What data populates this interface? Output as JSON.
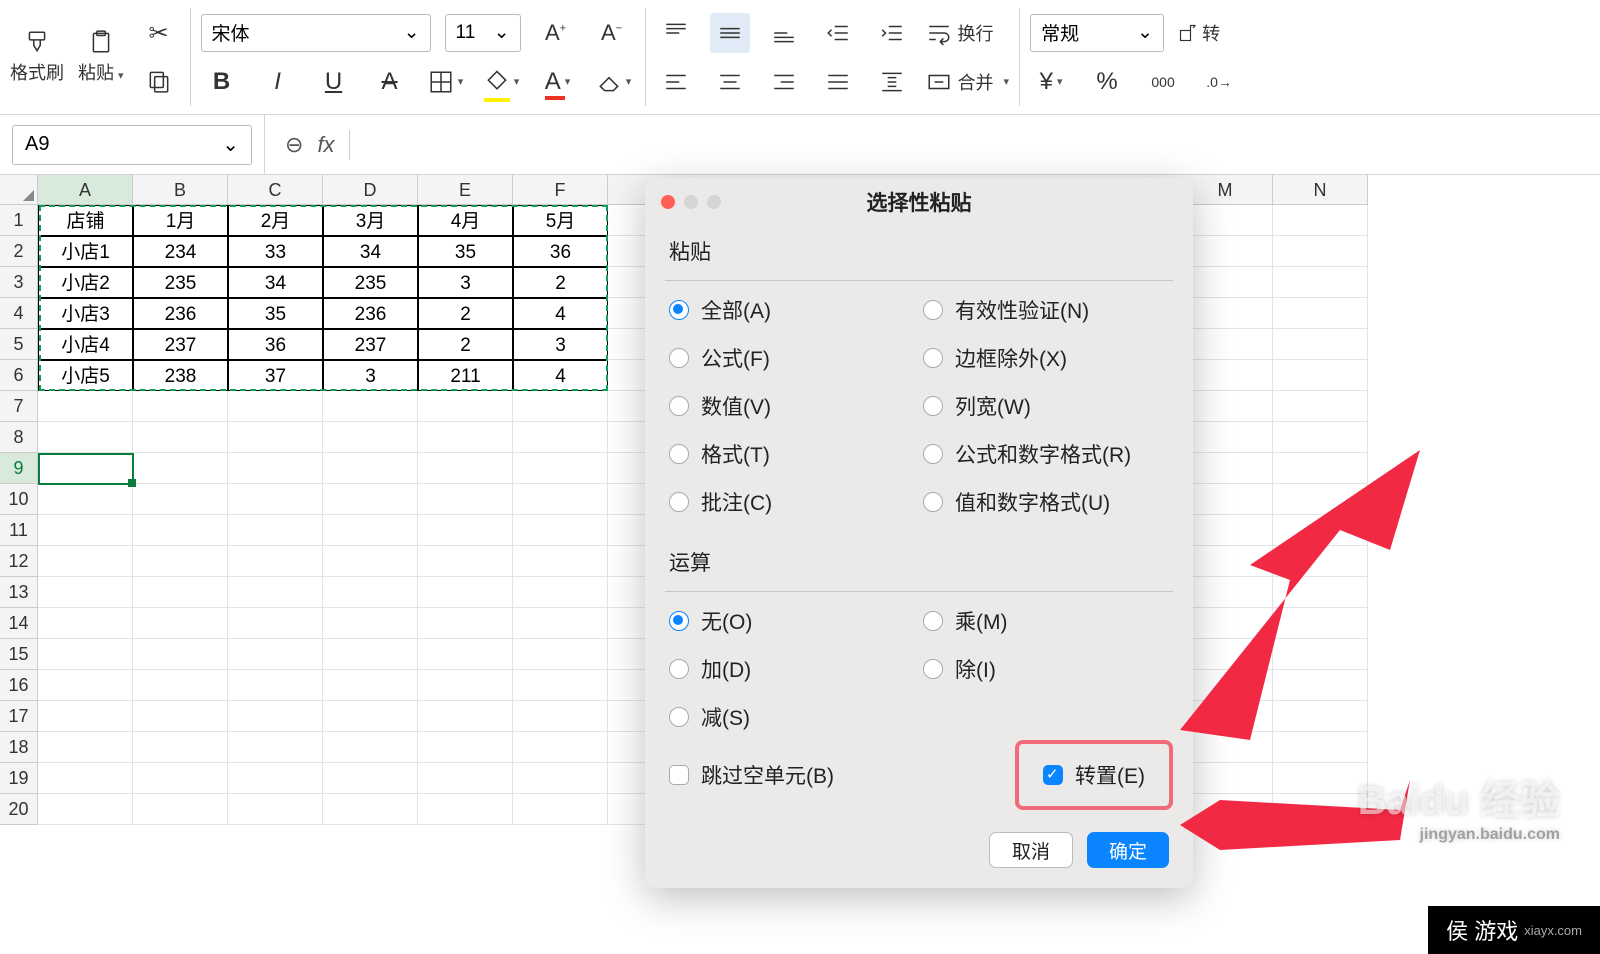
{
  "toolbar": {
    "format_painter": "格式刷",
    "paste": "粘贴",
    "font": "宋体",
    "font_size": "11",
    "wrap_text": "换行",
    "merge": "合并",
    "number_format": "常规",
    "transpose_btn": "转"
  },
  "namebox": {
    "cell_ref": "A9"
  },
  "columns": [
    "A",
    "B",
    "C",
    "D",
    "E",
    "F",
    "M",
    "N"
  ],
  "row_numbers": [
    1,
    2,
    3,
    4,
    5,
    6,
    7,
    8,
    9,
    10,
    11,
    12,
    13,
    14,
    15,
    16,
    17,
    18,
    19,
    20
  ],
  "data": [
    [
      "店铺",
      "1月",
      "2月",
      "3月",
      "4月",
      "5月"
    ],
    [
      "小店1",
      "234",
      "33",
      "34",
      "35",
      "36"
    ],
    [
      "小店2",
      "235",
      "34",
      "235",
      "3",
      "2"
    ],
    [
      "小店3",
      "236",
      "35",
      "236",
      "2",
      "4"
    ],
    [
      "小店4",
      "237",
      "36",
      "237",
      "2",
      "3"
    ],
    [
      "小店5",
      "238",
      "37",
      "3",
      "211",
      "4"
    ]
  ],
  "dialog": {
    "title": "选择性粘贴",
    "paste_section": "粘贴",
    "paste_options": {
      "all": "全部(A)",
      "formulas": "公式(F)",
      "values": "数值(V)",
      "formats": "格式(T)",
      "comments": "批注(C)",
      "validation": "有效性验证(N)",
      "except_borders": "边框除外(X)",
      "col_widths": "列宽(W)",
      "formulas_num": "公式和数字格式(R)",
      "values_num": "值和数字格式(U)"
    },
    "operation_section": "运算",
    "operation_options": {
      "none": "无(O)",
      "add": "加(D)",
      "subtract": "减(S)",
      "multiply": "乘(M)",
      "divide": "除(I)"
    },
    "skip_blanks": "跳过空单元(B)",
    "transpose": "转置(E)",
    "cancel": "取消",
    "ok": "确定"
  },
  "watermark": {
    "main": "Baidu 经验",
    "sub": "jingyan.baidu.com"
  },
  "corner_logo": {
    "text": "侯 游戏",
    "url": "xiayx.com"
  }
}
